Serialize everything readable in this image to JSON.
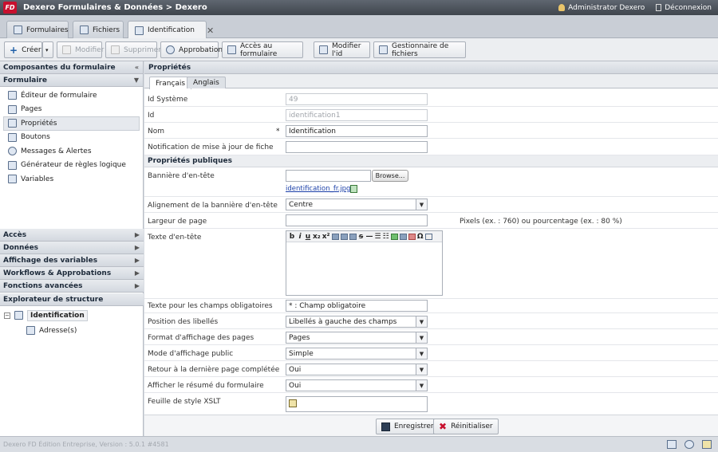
{
  "window": {
    "logo": "FD",
    "title": "Dexero Formulaires & Données > Dexero",
    "user": "Administrator Dexero",
    "logout": "Déconnexion"
  },
  "tabs": [
    {
      "label": "Formulaires",
      "icon": "forms-icon"
    },
    {
      "label": "Fichiers",
      "icon": "files-icon"
    },
    {
      "label": "Identification",
      "icon": "form-icon",
      "active": true
    }
  ],
  "toolbar": {
    "create": "Créer",
    "modify": "Modifier",
    "delete": "Supprimer",
    "approval": "Approbation",
    "form_access": "Accès au formulaire",
    "modify_id": "Modifier l'id",
    "file_manager": "Gestionnaire de fichiers"
  },
  "sidebar": {
    "components_title": "Composantes du formulaire",
    "form_title": "Formulaire",
    "items": [
      {
        "label": "Éditeur de formulaire",
        "icon": "form-editor-icon"
      },
      {
        "label": "Pages",
        "icon": "pages-icon"
      },
      {
        "label": "Propriétés",
        "icon": "properties-icon",
        "active": true
      },
      {
        "label": "Boutons",
        "icon": "buttons-icon"
      },
      {
        "label": "Messages & Alertes",
        "icon": "messages-icon"
      },
      {
        "label": "Générateur de règles logique",
        "icon": "rules-icon"
      },
      {
        "label": "Variables",
        "icon": "variables-icon"
      }
    ],
    "groups": [
      "Accès",
      "Données",
      "Affichage des variables",
      "Workflows & Approbations",
      "Fonctions avancées"
    ],
    "explorer_title": "Explorateur de structure",
    "tree": {
      "root": "Identification",
      "child": "Adresse(s)"
    }
  },
  "main": {
    "title": "Propriétés",
    "lang_tabs": [
      "Français",
      "Anglais"
    ],
    "fields": {
      "system_id": {
        "label": "Id Système",
        "value": "49"
      },
      "id": {
        "label": "Id",
        "value": "identification1"
      },
      "name": {
        "label": "Nom",
        "required": "*",
        "value": "Identification"
      },
      "notify": {
        "label": "Notification de mise à jour de fiche",
        "value": ""
      }
    },
    "public_section": "Propriétés publiques",
    "banner": {
      "label": "Bannière d'en-tête",
      "browse": "Browse...",
      "file": "identification_fr.jpg"
    },
    "banner_align": {
      "label": "Alignement de la bannière d'en-tête",
      "value": "Centre"
    },
    "page_width": {
      "label": "Largeur de page",
      "value": "",
      "hint": "Pixels (ex. : 760) ou pourcentage (ex. : 80 %)"
    },
    "header_text": {
      "label": "Texte d'en-tête"
    },
    "required_text": {
      "label": "Texte pour les champs obligatoires",
      "value": "* : Champ obligatoire"
    },
    "label_position": {
      "label": "Position des libellés",
      "value": "Libellés à gauche des champs"
    },
    "page_format": {
      "label": "Format d'affichage des pages",
      "value": "Pages"
    },
    "public_mode": {
      "label": "Mode d'affichage public",
      "value": "Simple"
    },
    "return_last": {
      "label": "Retour à la dernière page complétée",
      "value": "Oui"
    },
    "show_summary": {
      "label": "Afficher le résumé du formulaire",
      "value": "Oui"
    },
    "xslt": {
      "label": "Feuille de style XSLT"
    },
    "save": "Enregistrer",
    "reset": "Réinitialiser"
  },
  "status": {
    "text": "Dexero FD Édition Entreprise, Version : 5.0.1 #4581"
  }
}
